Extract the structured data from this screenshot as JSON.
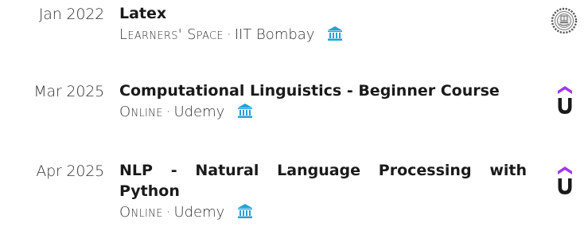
{
  "entries": [
    {
      "date": "Jan 2022",
      "title": "Latex",
      "type_label": "Learners' Space",
      "separator": "·",
      "provider": "IIT Bombay",
      "institution_icon": "bank-icon",
      "logo": "iit-bombay-logo"
    },
    {
      "date": "Mar 2025",
      "title": "Computational Linguistics - Beginner Course",
      "type_label": "Online",
      "separator": "·",
      "provider": "Udemy",
      "institution_icon": "bank-icon",
      "logo": "udemy-logo"
    },
    {
      "date": "Apr 2025",
      "title": "NLP - Natural Language Processing with Python",
      "type_label": "Online",
      "separator": "·",
      "provider": "Udemy",
      "institution_icon": "bank-icon",
      "logo": "udemy-logo"
    }
  ],
  "colors": {
    "icon_accent": "#1fa3d6",
    "udemy_purple": "#a435f0",
    "text": "#222222"
  }
}
